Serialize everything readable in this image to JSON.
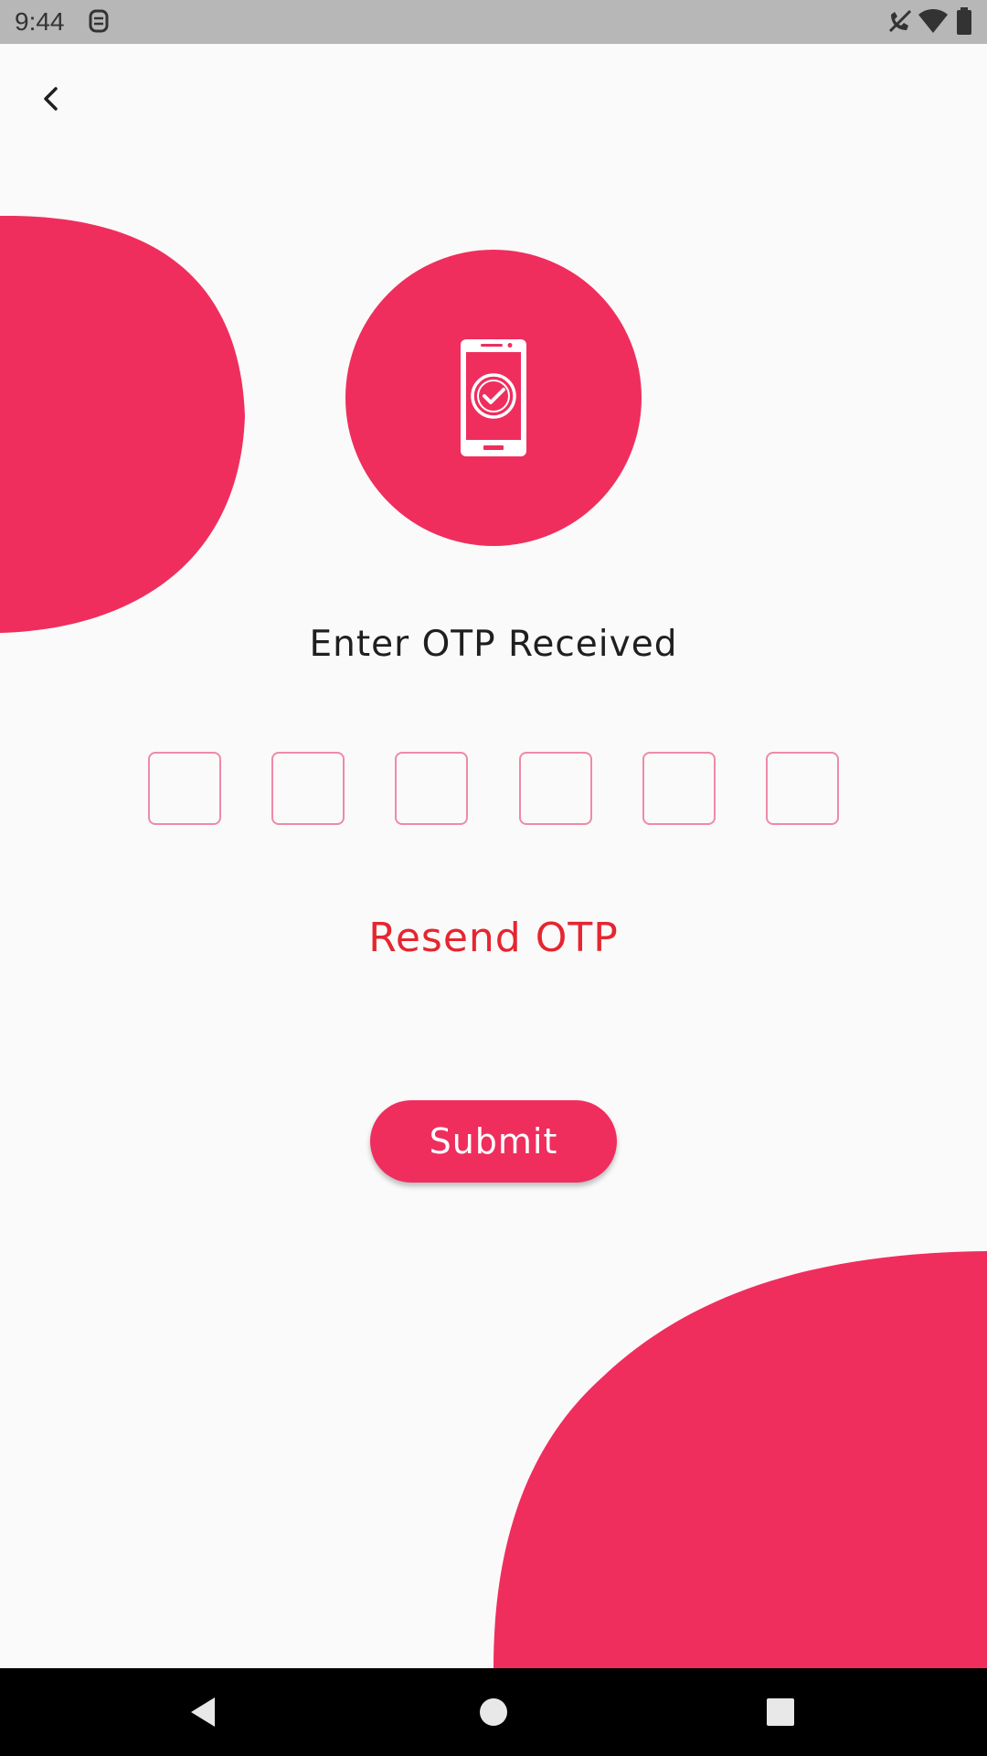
{
  "status_bar": {
    "time": "9:44",
    "icons": [
      "notification-icon",
      "call-muted-icon",
      "wifi-icon",
      "battery-icon"
    ]
  },
  "header": {
    "back_icon": "chevron-left-icon"
  },
  "hero": {
    "icon": "phone-check-icon"
  },
  "title": "Enter OTP Received",
  "otp": {
    "digits": [
      "",
      "",
      "",
      "",
      "",
      ""
    ]
  },
  "resend_label": "Resend OTP",
  "submit_label": "Submit",
  "nav": {
    "back_icon": "nav-back-icon",
    "home_icon": "nav-home-icon",
    "recents_icon": "nav-recents-icon"
  },
  "colors": {
    "accent": "#ef2e5e",
    "resend": "#e52630",
    "otp_border": "#ef8aa6",
    "background": "#fafafa",
    "status_bar": "#b7b7b7"
  }
}
